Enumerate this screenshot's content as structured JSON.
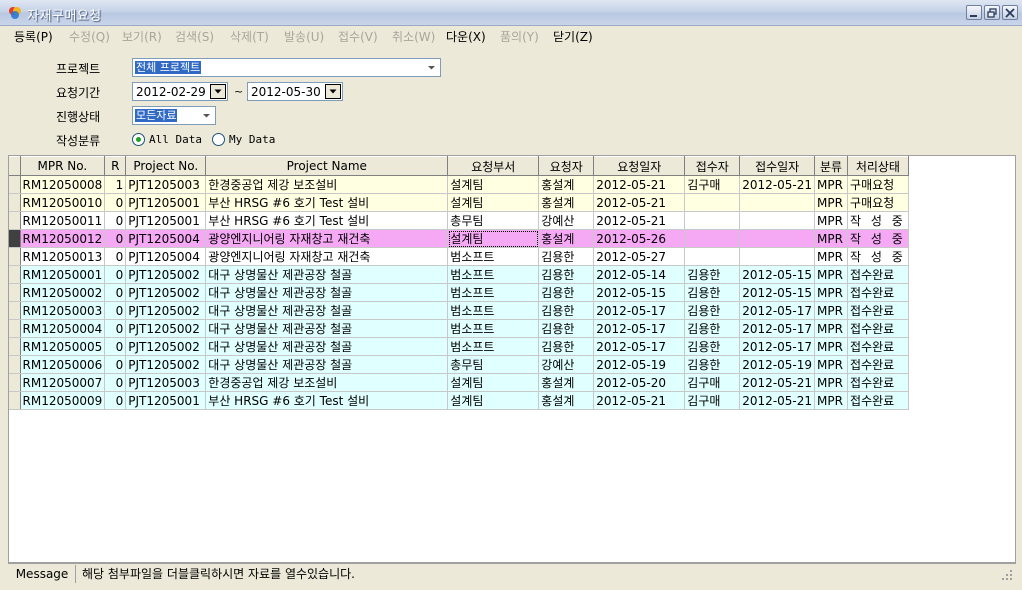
{
  "window": {
    "title": "자재구매요청",
    "colors": {
      "title_gradient": "#c6d3e8",
      "selection": "#316ac5",
      "row_yellow": "#ffffe1",
      "row_pink": "#f5a9f5",
      "row_cyan": "#e0ffff"
    }
  },
  "menu": [
    {
      "label": "등록(P)",
      "enabled": true
    },
    {
      "label": "수정(Q)",
      "enabled": false
    },
    {
      "label": "보기(R)",
      "enabled": false
    },
    {
      "label": "검색(S)",
      "enabled": false
    },
    {
      "label": "삭제(T)",
      "enabled": false
    },
    {
      "label": "발송(U)",
      "enabled": false
    },
    {
      "label": "접수(V)",
      "enabled": false
    },
    {
      "label": "취소(W)",
      "enabled": false
    },
    {
      "label": "다운(X)",
      "enabled": true
    },
    {
      "label": "품의(Y)",
      "enabled": false
    },
    {
      "label": "닫기(Z)",
      "enabled": true
    }
  ],
  "filters": {
    "project": {
      "label": "프로젝트",
      "value": "전체 프로젝트"
    },
    "period": {
      "label": "요청기간",
      "from": "2012-02-29",
      "to": "2012-05-30",
      "separator": "~"
    },
    "status": {
      "label": "진행상태",
      "value": "모든자료"
    },
    "category": {
      "label": "작성분류",
      "options": [
        "All Data",
        "My Data"
      ],
      "selected": "All Data"
    }
  },
  "grid": {
    "columns": [
      "MPR No.",
      "R",
      "Project No.",
      "Project Name",
      "요청부서",
      "요청자",
      "요청일자",
      "접수자",
      "접수일자",
      "분류",
      "처리상태"
    ],
    "rows": [
      {
        "cells": [
          "RM12050008",
          "1",
          "PJT1205003",
          "한경중공업 제강 보조설비",
          "설계팀",
          "홍설계",
          "2012-05-21",
          "김구매",
          "2012-05-21",
          "MPR",
          "구매요청"
        ],
        "color": "yellow"
      },
      {
        "cells": [
          "RM12050010",
          "0",
          "PJT1205001",
          "부산 HRSG #6 호기 Test 설비",
          "설계팀",
          "홍설계",
          "2012-05-21",
          "",
          "",
          "MPR",
          "구매요청"
        ],
        "color": "yellow"
      },
      {
        "cells": [
          "RM12050011",
          "0",
          "PJT1205001",
          "부산 HRSG #6 호기 Test 설비",
          "총무팀",
          "강예산",
          "2012-05-21",
          "",
          "",
          "MPR",
          "작 성 중"
        ],
        "color": "white"
      },
      {
        "cells": [
          "RM12050012",
          "0",
          "PJT1205004",
          "광양엔지니어링 자재창고 재건축",
          "설계팀",
          "홍설계",
          "2012-05-26",
          "",
          "",
          "MPR",
          "작 성 중"
        ],
        "color": "pink"
      },
      {
        "cells": [
          "RM12050013",
          "0",
          "PJT1205004",
          "광양엔지니어링 자재창고 재건축",
          "범소프트",
          "김용한",
          "2012-05-27",
          "",
          "",
          "MPR",
          "작 성 중"
        ],
        "color": "white"
      },
      {
        "cells": [
          "RM12050001",
          "0",
          "PJT1205002",
          "대구 상명물산 제관공장 철골",
          "범소프트",
          "김용한",
          "2012-05-14",
          "김용한",
          "2012-05-15",
          "MPR",
          "접수완료"
        ],
        "color": "cyan"
      },
      {
        "cells": [
          "RM12050002",
          "0",
          "PJT1205002",
          "대구 상명물산 제관공장 철골",
          "범소프트",
          "김용한",
          "2012-05-15",
          "김용한",
          "2012-05-15",
          "MPR",
          "접수완료"
        ],
        "color": "cyan"
      },
      {
        "cells": [
          "RM12050003",
          "0",
          "PJT1205002",
          "대구 상명물산 제관공장 철골",
          "범소프트",
          "김용한",
          "2012-05-17",
          "김용한",
          "2012-05-17",
          "MPR",
          "접수완료"
        ],
        "color": "cyan"
      },
      {
        "cells": [
          "RM12050004",
          "0",
          "PJT1205002",
          "대구 상명물산 제관공장 철골",
          "범소프트",
          "김용한",
          "2012-05-17",
          "김용한",
          "2012-05-17",
          "MPR",
          "접수완료"
        ],
        "color": "cyan"
      },
      {
        "cells": [
          "RM12050005",
          "0",
          "PJT1205002",
          "대구 상명물산 제관공장 철골",
          "범소프트",
          "김용한",
          "2012-05-17",
          "김용한",
          "2012-05-17",
          "MPR",
          "접수완료"
        ],
        "color": "cyan"
      },
      {
        "cells": [
          "RM12050006",
          "0",
          "PJT1205002",
          "대구 상명물산 제관공장 철골",
          "총무팀",
          "강예산",
          "2012-05-19",
          "김용한",
          "2012-05-19",
          "MPR",
          "접수완료"
        ],
        "color": "cyan"
      },
      {
        "cells": [
          "RM12050007",
          "0",
          "PJT1205003",
          "한경중공업 제강 보조설비",
          "설계팀",
          "홍설계",
          "2012-05-20",
          "김구매",
          "2012-05-21",
          "MPR",
          "접수완료"
        ],
        "color": "cyan"
      },
      {
        "cells": [
          "RM12050009",
          "0",
          "PJT1205001",
          "부산 HRSG #6 호기 Test 설비",
          "설계팀",
          "홍설계",
          "2012-05-21",
          "김구매",
          "2012-05-21",
          "MPR",
          "접수완료"
        ],
        "color": "cyan"
      }
    ]
  },
  "statusbar": {
    "label": "Message",
    "message": "해당 첨부파일을 더블클릭하시면 자료를 열수있습니다."
  }
}
